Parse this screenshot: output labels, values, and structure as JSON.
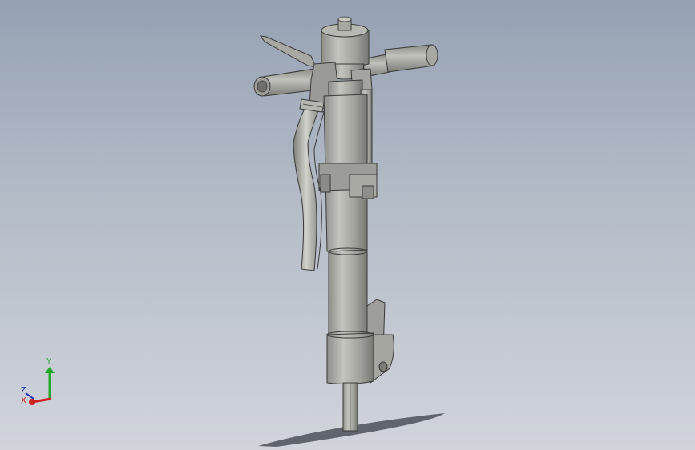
{
  "viewport": {
    "background_top": "#95a1b3",
    "background_bottom": "#d1d4db",
    "model_color": "#a6a6a2"
  },
  "triad": {
    "x_label": "X",
    "y_label": "Y",
    "z_label": "Z",
    "x_color": "#d11f1f",
    "y_color": "#1fa82a",
    "z_color": "#2433b8"
  }
}
